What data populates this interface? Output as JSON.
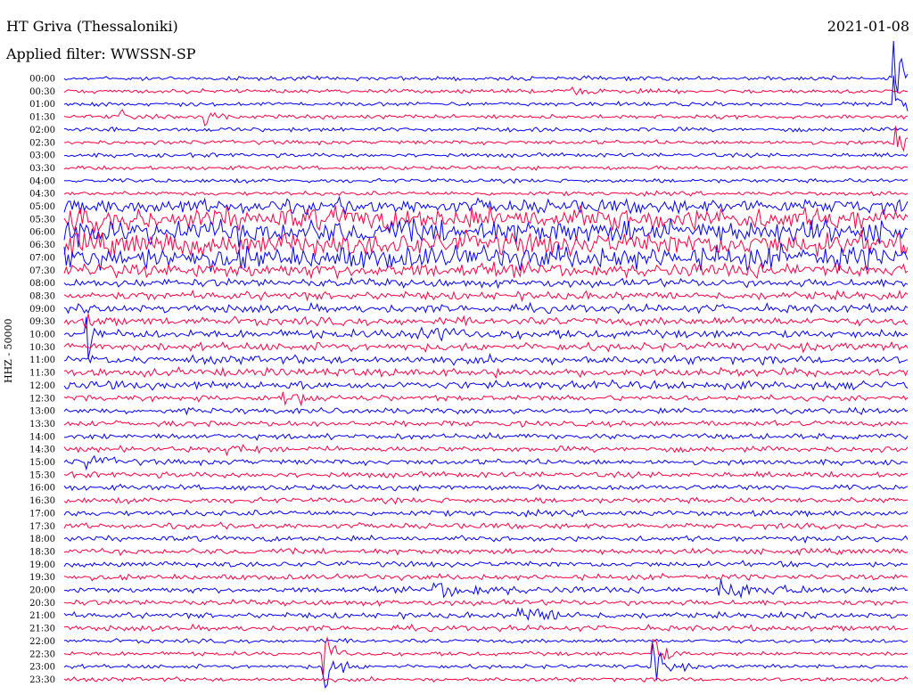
{
  "header": {
    "station": "HT Griva (Thessaloniki)",
    "date": "2021-01-08",
    "filter": "Applied filter: WWSSN-SP"
  },
  "chart_data": {
    "type": "line",
    "title": "HT Griva (Thessaloniki)",
    "subtitle": "Applied filter: WWSSN-SP",
    "date": "2021-01-08",
    "ylabel": "HHZ - 50000",
    "xlabel": "",
    "row_labels": [
      "00:00",
      "00:30",
      "01:00",
      "01:30",
      "02:00",
      "02:30",
      "03:00",
      "03:30",
      "04:00",
      "04:30",
      "05:00",
      "05:30",
      "06:00",
      "06:30",
      "07:00",
      "07:30",
      "08:00",
      "08:30",
      "09:00",
      "09:30",
      "10:00",
      "10:30",
      "11:00",
      "11:30",
      "12:00",
      "12:30",
      "13:00",
      "13:30",
      "14:00",
      "14:30",
      "15:00",
      "15:30",
      "16:00",
      "16:30",
      "17:00",
      "17:30",
      "18:00",
      "18:30",
      "19:00",
      "19:30",
      "20:00",
      "20:30",
      "21:00",
      "21:30",
      "22:00",
      "22:30",
      "23:00",
      "23:30"
    ],
    "row_colors": [
      "#0000ff",
      "#ff0040"
    ],
    "trace_minutes": 30,
    "grid": false,
    "legend": "none"
  }
}
